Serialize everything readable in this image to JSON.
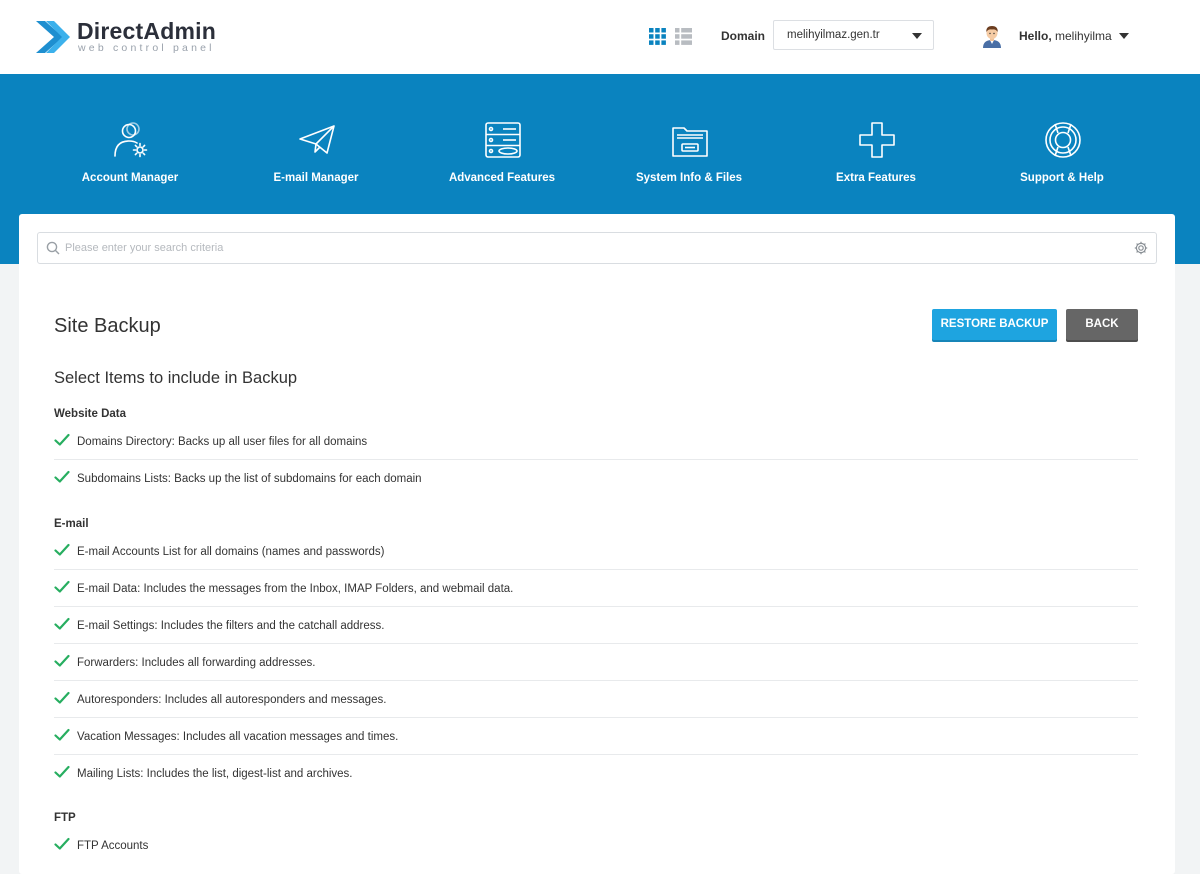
{
  "header": {
    "brand": "DirectAdmin",
    "brand_sub": "web control panel",
    "domain_label": "Domain",
    "domain_value": "melihyilmaz.gen.tr",
    "hello_prefix": "Hello,",
    "username": "melihyilma"
  },
  "nav": [
    {
      "label": "Account Manager",
      "icon": "account-manager-icon"
    },
    {
      "label": "E-mail Manager",
      "icon": "email-manager-icon"
    },
    {
      "label": "Advanced Features",
      "icon": "advanced-features-icon"
    },
    {
      "label": "System Info & Files",
      "icon": "system-info-icon"
    },
    {
      "label": "Extra Features",
      "icon": "extra-features-icon"
    },
    {
      "label": "Support & Help",
      "icon": "support-help-icon"
    }
  ],
  "search": {
    "placeholder": "Please enter your search criteria"
  },
  "page": {
    "title": "Site Backup",
    "restore_label": "RESTORE BACKUP",
    "back_label": "BACK",
    "section_title": "Select Items to include in Backup"
  },
  "groups": [
    {
      "title": "Website Data",
      "items": [
        {
          "label": "Domains Directory: Backs up all user files for all domains",
          "checked": true
        },
        {
          "label": "Subdomains Lists: Backs up the list of subdomains for each domain",
          "checked": true
        }
      ]
    },
    {
      "title": "E-mail",
      "items": [
        {
          "label": "E-mail Accounts List for all domains (names and passwords)",
          "checked": true
        },
        {
          "label": "E-mail Data: Includes the messages from the Inbox, IMAP Folders, and webmail data.",
          "checked": true
        },
        {
          "label": "E-mail Settings: Includes the filters and the catchall address.",
          "checked": true
        },
        {
          "label": "Forwarders: Includes all forwarding addresses.",
          "checked": true
        },
        {
          "label": "Autoresponders: Includes all autoresponders and messages.",
          "checked": true
        },
        {
          "label": "Vacation Messages: Includes all vacation messages and times.",
          "checked": true
        },
        {
          "label": "Mailing Lists: Includes the list, digest-list and archives.",
          "checked": true
        }
      ]
    },
    {
      "title": "FTP",
      "items": [
        {
          "label": "FTP Accounts",
          "checked": true
        }
      ]
    }
  ],
  "colors": {
    "hero": "#0a83bf",
    "accent": "#1ea4e0",
    "check": "#27ae60",
    "back": "#666666"
  }
}
